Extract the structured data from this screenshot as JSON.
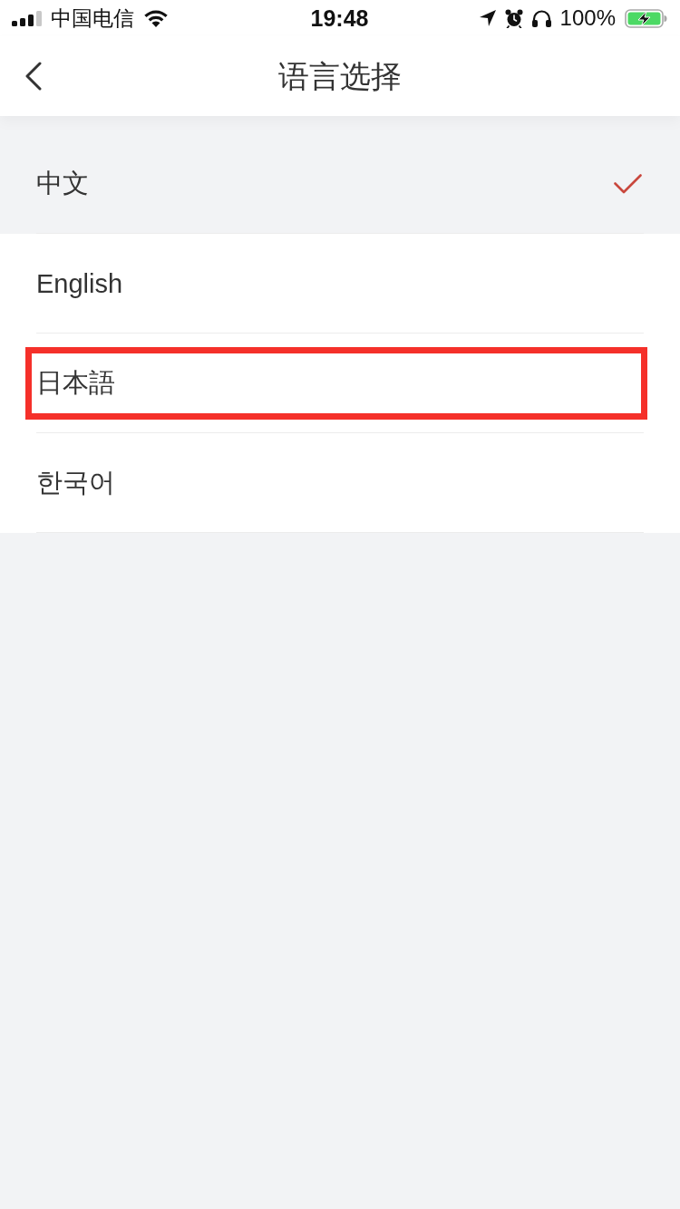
{
  "status_bar": {
    "carrier": "中国电信",
    "time": "19:48",
    "battery": "100%"
  },
  "nav": {
    "title": "语言选择"
  },
  "languages": [
    {
      "label": "中文",
      "selected": true,
      "highlighted": false
    },
    {
      "label": "English",
      "selected": false,
      "highlighted": false
    },
    {
      "label": "日本語",
      "selected": false,
      "highlighted": true
    },
    {
      "label": "한국어",
      "selected": false,
      "highlighted": false
    }
  ]
}
